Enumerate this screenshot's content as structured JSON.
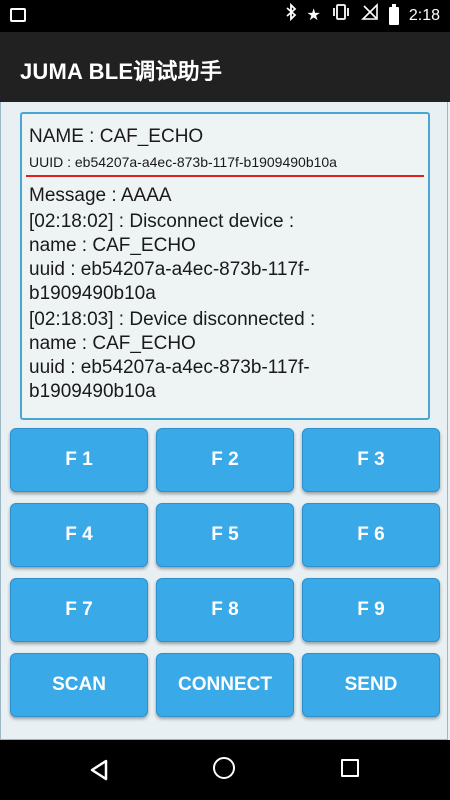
{
  "status_bar": {
    "time": "2:18",
    "icons": [
      "image-notification-icon",
      "bluetooth-icon",
      "star-icon",
      "vibrate-icon",
      "no-signal-icon",
      "battery-icon"
    ]
  },
  "app_bar": {
    "title": "JUMA BLE调试助手"
  },
  "device": {
    "name": "NAME : CAF_ECHO",
    "uuid": "UUID : eb54207a-a4ec-873b-117f-b1909490b10a"
  },
  "log": {
    "message": "Message : AAAA",
    "entries": [
      {
        "line1": "[02:18:02] : Disconnect device :",
        "line2": "name : CAF_ECHO",
        "line3": "uuid : eb54207a-a4ec-873b-117f-",
        "line4": "b1909490b10a"
      },
      {
        "line1": "[02:18:03] : Device disconnected :",
        "line2": "name : CAF_ECHO",
        "line3": "uuid : eb54207a-a4ec-873b-117f-",
        "line4": "b1909490b10a"
      }
    ]
  },
  "buttons": {
    "f1": "F 1",
    "f2": "F 2",
    "f3": "F 3",
    "f4": "F 4",
    "f5": "F 5",
    "f6": "F 6",
    "f7": "F 7",
    "f8": "F 8",
    "f9": "F 9",
    "scan": "SCAN",
    "connect": "CONNECT",
    "send": "SEND"
  },
  "colors": {
    "button": "#39a9e8",
    "app_bar": "#212121",
    "panel_border": "#47a6d2",
    "underline": "#e02020"
  }
}
